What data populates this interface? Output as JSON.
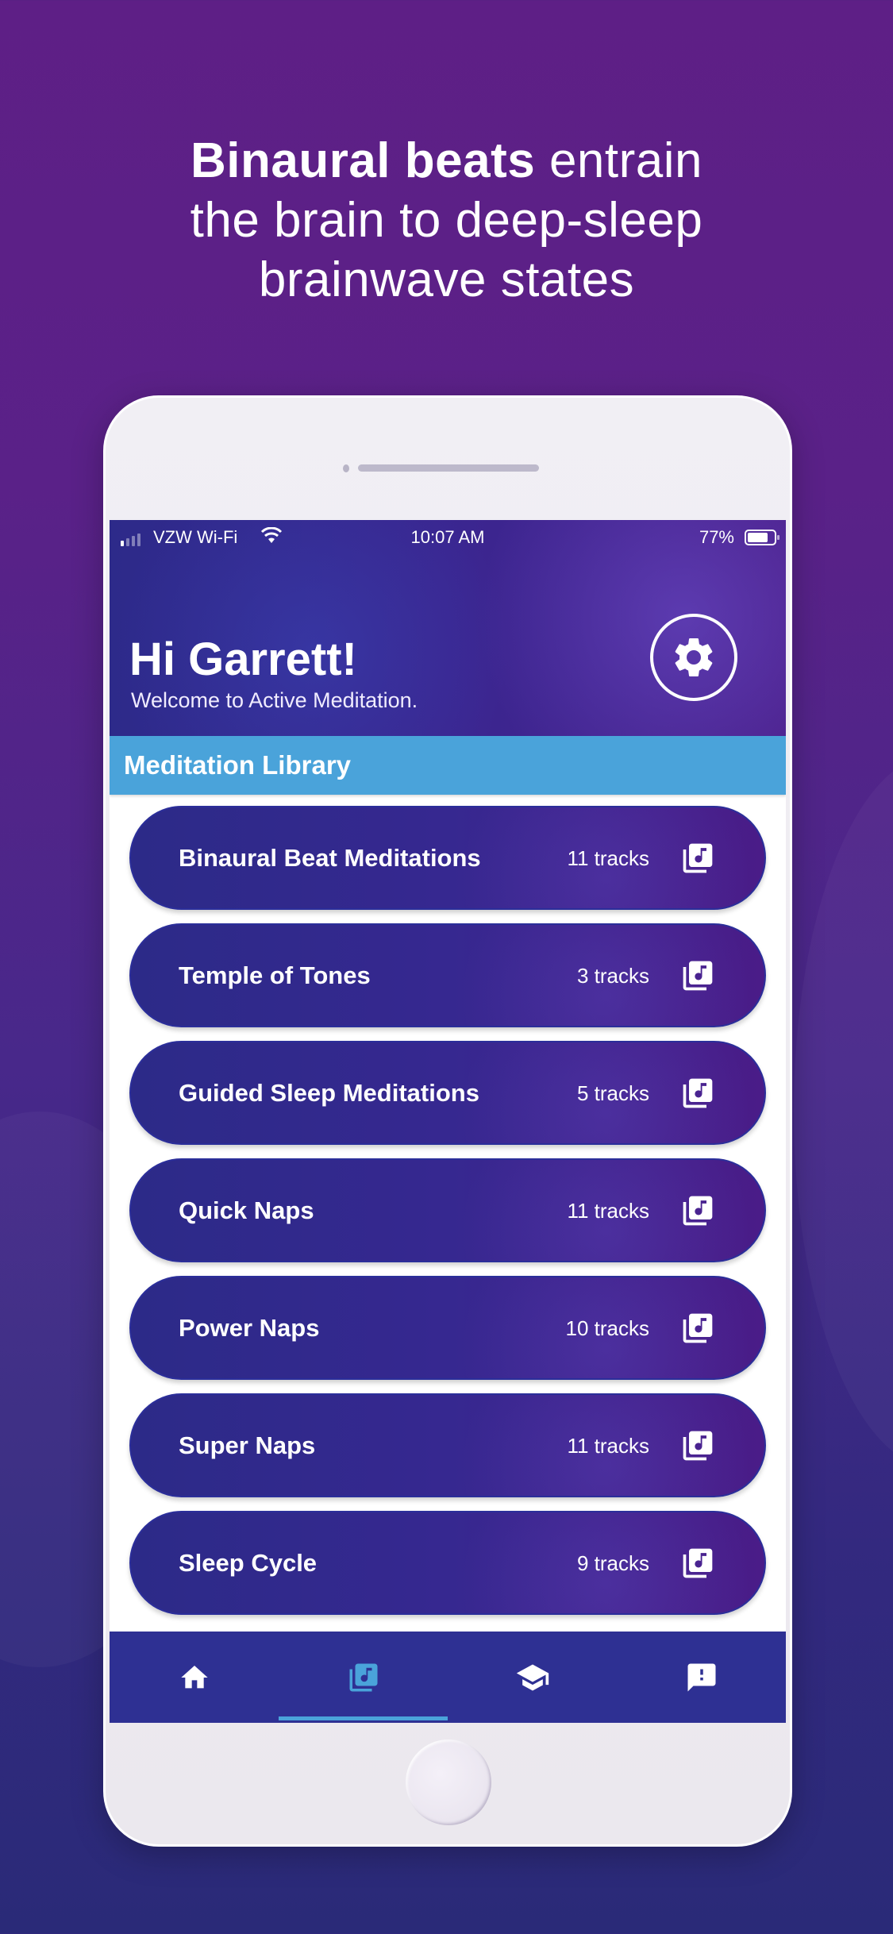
{
  "headline": {
    "bold": "Binaural beats",
    "rest_line1": " entrain",
    "line2": "the brain to deep-sleep",
    "line3": "brainwave states"
  },
  "status_bar": {
    "carrier": "VZW Wi-Fi",
    "time": "10:07 AM",
    "battery_percent": "77%",
    "battery_level": 0.77,
    "signal_bars": 1
  },
  "header": {
    "greeting": "Hi Garrett!",
    "subtitle": "Welcome to Active Meditation.",
    "settings_icon": "gear-icon"
  },
  "section": {
    "title": "Meditation Library"
  },
  "library": [
    {
      "title": "Binaural Beat Meditations",
      "count": "11 tracks"
    },
    {
      "title": "Temple of Tones",
      "count": "3 tracks"
    },
    {
      "title": "Guided Sleep Meditations",
      "count": "5 tracks"
    },
    {
      "title": "Quick Naps",
      "count": "11 tracks"
    },
    {
      "title": "Power Naps",
      "count": "10 tracks"
    },
    {
      "title": "Super Naps",
      "count": "11 tracks"
    },
    {
      "title": "Sleep Cycle",
      "count": "9 tracks"
    }
  ],
  "tabs": [
    {
      "icon": "home-icon",
      "active": false
    },
    {
      "icon": "library-music-icon",
      "active": true
    },
    {
      "icon": "school-icon",
      "active": false
    },
    {
      "icon": "feedback-icon",
      "active": false
    }
  ],
  "colors": {
    "accent": "#4aa3da",
    "tabbar": "#2e3093",
    "row_start": "#2c2a88",
    "row_end": "#4a1c88",
    "bg_top": "#5e1f86",
    "bg_bottom": "#2a2a78"
  }
}
